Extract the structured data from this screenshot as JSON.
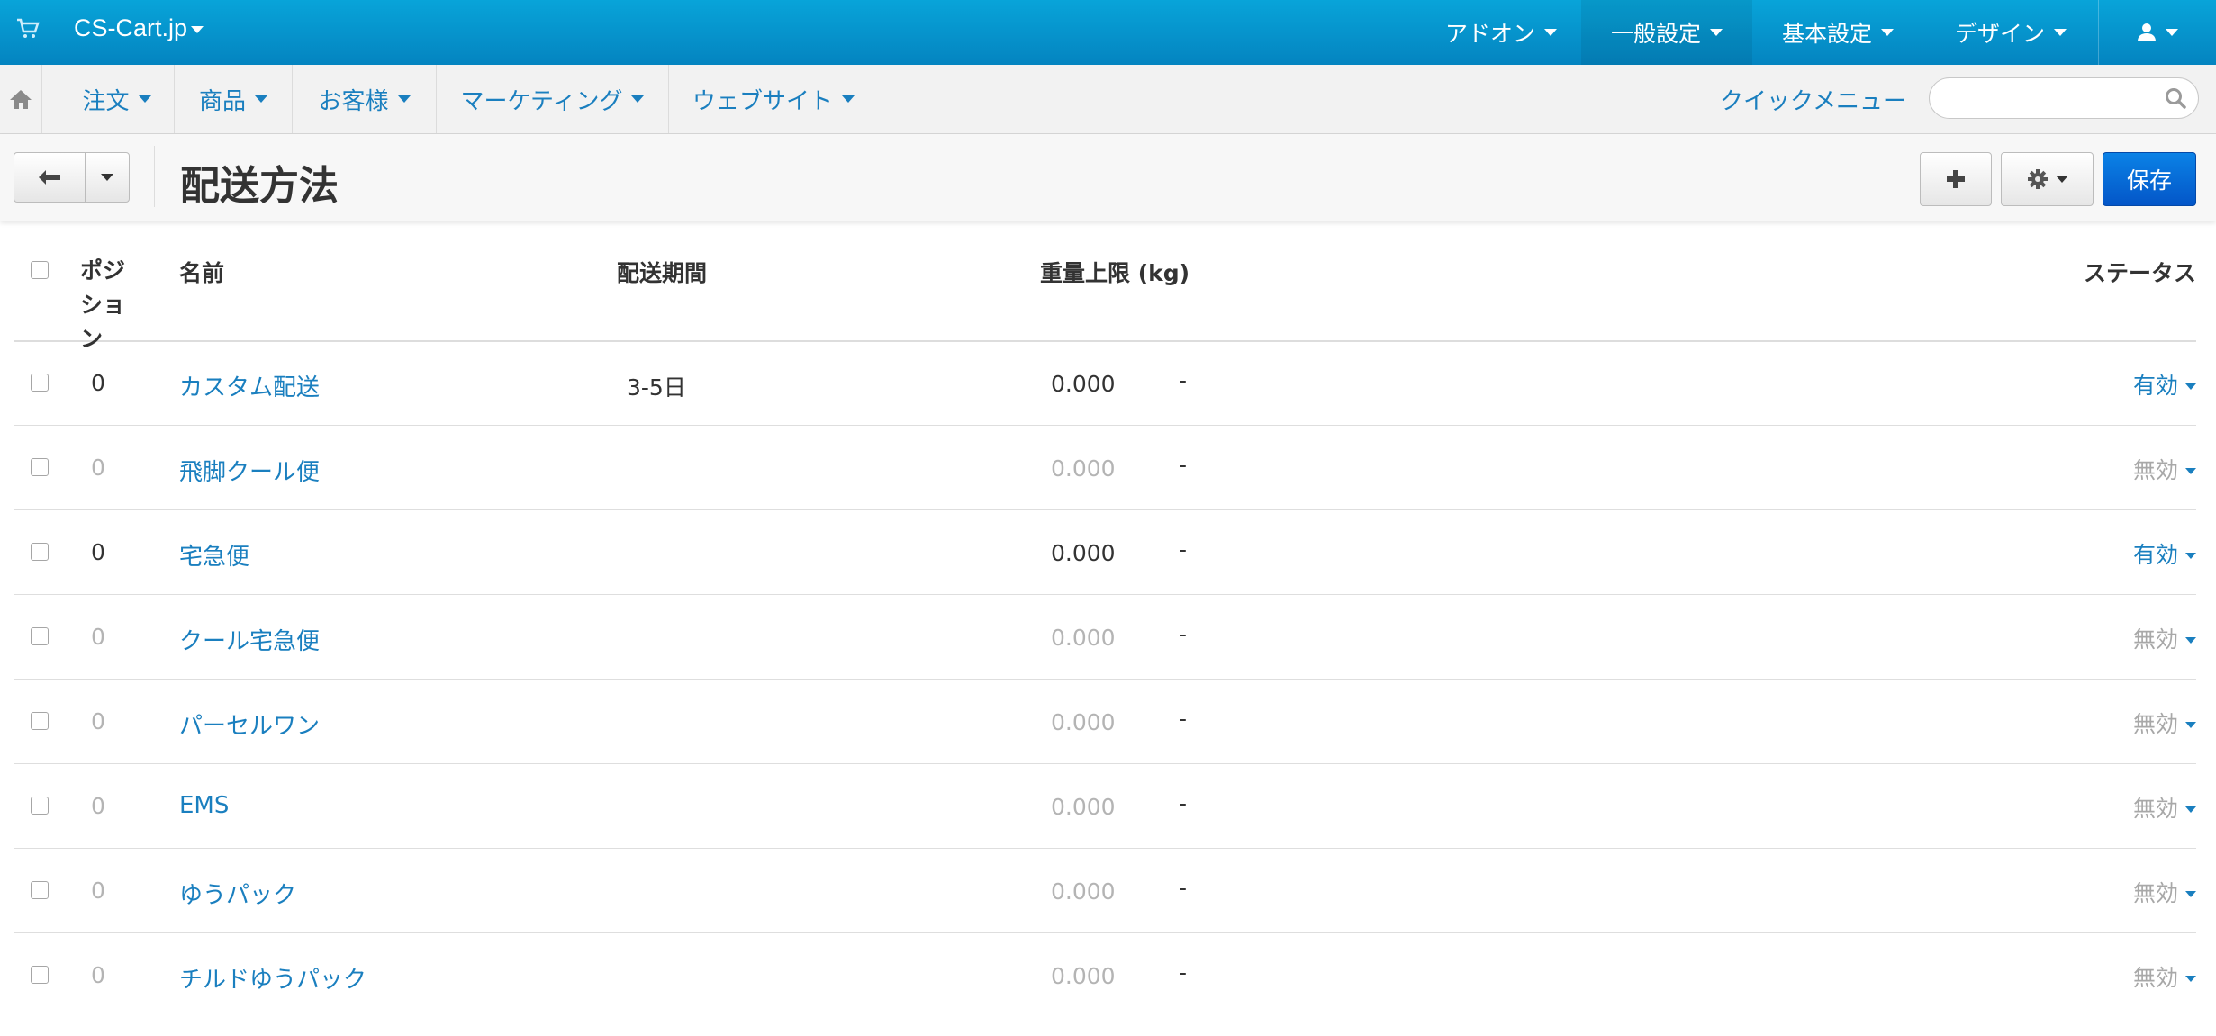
{
  "topbar": {
    "brand": "CS-Cart.jp",
    "menus": [
      "アドオン",
      "一般設定",
      "基本設定",
      "デザイン"
    ]
  },
  "navbar": {
    "items": [
      "注文",
      "商品",
      "お客様",
      "マーケティング",
      "ウェブサイト"
    ],
    "quick_menu": "クイックメニュー",
    "search_placeholder": ""
  },
  "toolbar": {
    "title": "配送方法",
    "save_label": "保存"
  },
  "table": {
    "headers": {
      "position": "ポジション",
      "name": "名前",
      "period": "配送期間",
      "weight": "重量上限 (kg)",
      "status": "ステータス"
    },
    "rows": [
      {
        "position": "0",
        "name": "カスタム配送",
        "period": "3-5日",
        "weight": "0.000",
        "weight_max": "-",
        "status": "有効"
      },
      {
        "position": "0",
        "name": "飛脚クール便",
        "period": "",
        "weight": "0.000",
        "weight_max": "-",
        "status": "無効"
      },
      {
        "position": "0",
        "name": "宅急便",
        "period": "",
        "weight": "0.000",
        "weight_max": "-",
        "status": "有効"
      },
      {
        "position": "0",
        "name": "クール宅急便",
        "period": "",
        "weight": "0.000",
        "weight_max": "-",
        "status": "無効"
      },
      {
        "position": "0",
        "name": "パーセルワン",
        "period": "",
        "weight": "0.000",
        "weight_max": "-",
        "status": "無効"
      },
      {
        "position": "0",
        "name": "EMS",
        "period": "",
        "weight": "0.000",
        "weight_max": "-",
        "status": "無効"
      },
      {
        "position": "0",
        "name": "ゆうパック",
        "period": "",
        "weight": "0.000",
        "weight_max": "-",
        "status": "無効"
      },
      {
        "position": "0",
        "name": "チルドゆうパック",
        "period": "",
        "weight": "0.000",
        "weight_max": "-",
        "status": "無効"
      }
    ]
  },
  "colors": {
    "topbar": "#0496d0",
    "link": "#1a7fbf",
    "save_button": "#0563d6",
    "disabled_text": "#b4b4b4"
  },
  "icons": [
    "cart-icon",
    "home-icon",
    "user-icon",
    "search-icon",
    "back-arrow-icon",
    "plus-icon",
    "gear-icon",
    "caret-down-icon"
  ]
}
